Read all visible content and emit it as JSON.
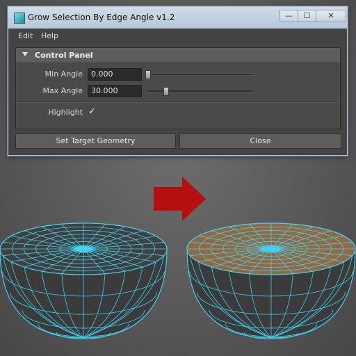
{
  "window": {
    "title": "Grow Selection By Edge Angle v1.2",
    "controls": {
      "minimize": "—",
      "maximize": "☐",
      "close": "✕"
    }
  },
  "menu": {
    "items": [
      "Edit",
      "Help"
    ]
  },
  "control_panel": {
    "title": "Control Panel",
    "min_angle": {
      "label": "Min Angle",
      "value": "0.000",
      "slider_level": 0.0
    },
    "max_angle": {
      "label": "Max Angle",
      "value": "30.000",
      "slider_level": 0.17
    },
    "highlight": {
      "label": "Highlight",
      "checked": true,
      "check_glyph": "✓"
    }
  },
  "buttons": {
    "set_target": "Set Target Geometry",
    "close": "Close"
  },
  "scene": {
    "arrow_color": "#b50f0f",
    "wire_color": "#41d2f0",
    "selection_color": "#b07a4a",
    "mesh_face_color": "#3b3b3b"
  }
}
